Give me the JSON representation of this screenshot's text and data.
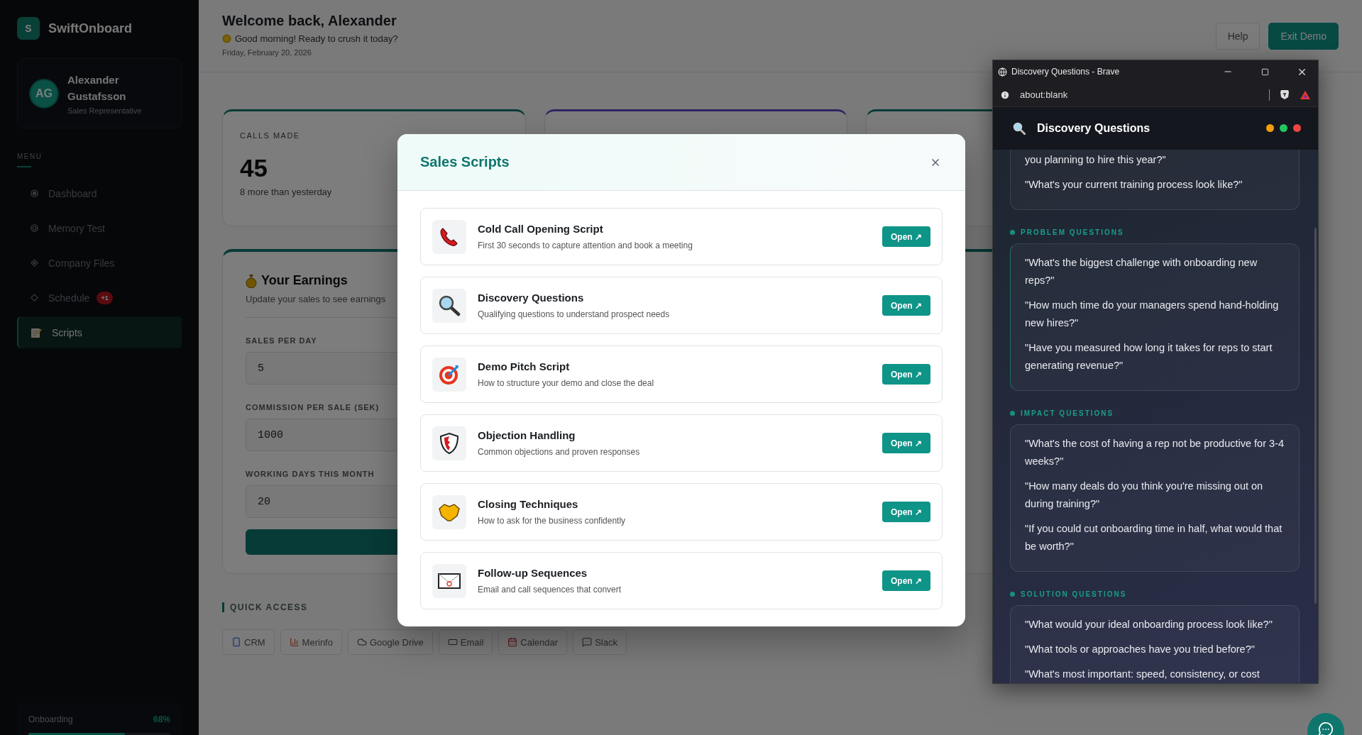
{
  "sidebar": {
    "logo_letter": "S",
    "brand": "SwiftOnboard",
    "user": {
      "initials": "AG",
      "name": "Alexander Gustafsson",
      "role": "Sales Representative"
    },
    "menu_label": "MENU",
    "items": [
      {
        "label": "Dashboard",
        "selected": false
      },
      {
        "label": "Memory Test",
        "selected": false
      },
      {
        "label": "Company Files",
        "selected": false
      },
      {
        "label": "Schedule",
        "selected": false,
        "badge": "+1"
      },
      {
        "label": "Scripts",
        "selected": true
      }
    ],
    "onboarding": {
      "label": "Onboarding",
      "reading": "68%",
      "level": 0.68
    }
  },
  "header": {
    "title": "Welcome back, Alexander",
    "greeting": "Good morning! Ready to crush it today?",
    "date": "Friday, February 20, 2026",
    "buttons": [
      {
        "label": "Help",
        "kind": "outline"
      },
      {
        "label": "Exit Demo",
        "kind": "solid"
      }
    ]
  },
  "stats": [
    {
      "label": "CALLS MADE",
      "value": "45",
      "note": "8 more than yesterday"
    }
  ],
  "earnings": {
    "title": "Your Earnings",
    "subtitle": "Update your sales to see earnings",
    "fields": [
      {
        "label": "SALES PER DAY",
        "value": "5"
      },
      {
        "label": "COMMISSION PER SALE (SEK)",
        "value": "1000"
      },
      {
        "label": "WORKING DAYS THIS MONTH",
        "value": "20"
      }
    ]
  },
  "quick_access": {
    "title": "QUICK ACCESS",
    "links": [
      {
        "label": "CRM"
      },
      {
        "label": "Merinfo"
      },
      {
        "label": "Google Drive"
      },
      {
        "label": "Email"
      },
      {
        "label": "Calendar"
      },
      {
        "label": "Slack"
      }
    ]
  },
  "modal": {
    "title": "Sales Scripts",
    "scripts": [
      {
        "title": "Cold Call Opening Script",
        "description": "First 30 seconds to capture attention and book a meeting",
        "action": "Open ↗"
      },
      {
        "title": "Discovery Questions",
        "description": "Qualifying questions to understand prospect needs",
        "action": "Open ↗"
      },
      {
        "title": "Demo Pitch Script",
        "description": "How to structure your demo and close the deal",
        "action": "Open ↗"
      },
      {
        "title": "Objection Handling",
        "description": "Common objections and proven responses",
        "action": "Open ↗"
      },
      {
        "title": "Closing Techniques",
        "description": "How to ask for the business confidently",
        "action": "Open ↗"
      },
      {
        "title": "Follow-up Sequences",
        "description": "Email and call sequences that convert",
        "action": "Open ↗"
      }
    ]
  },
  "popup": {
    "window_title": "Discovery Questions - Brave",
    "url": "about:blank",
    "title": "Discovery Questions",
    "lead_questions": [
      "you planning to hire this year?\"",
      "\"What's your current training process look like?\""
    ],
    "sections": [
      {
        "title": "PROBLEM QUESTIONS",
        "questions": [
          "\"What's the biggest challenge with onboarding new reps?\"",
          "\"How much time do your managers spend hand-holding new hires?\"",
          "\"Have you measured how long it takes for reps to start generating revenue?\""
        ]
      },
      {
        "title": "IMPACT QUESTIONS",
        "questions": [
          "\"What's the cost of having a rep not be productive for 3-4 weeks?\"",
          "\"How many deals do you think you're missing out on during training?\"",
          "\"If you could cut onboarding time in half, what would that be worth?\""
        ]
      },
      {
        "title": "SOLUTION QUESTIONS",
        "questions": [
          "\"What would your ideal onboarding process look like?\"",
          "\"What tools or approaches have you tried before?\"",
          "\"What's most important: speed, consistency, or cost"
        ]
      }
    ]
  }
}
